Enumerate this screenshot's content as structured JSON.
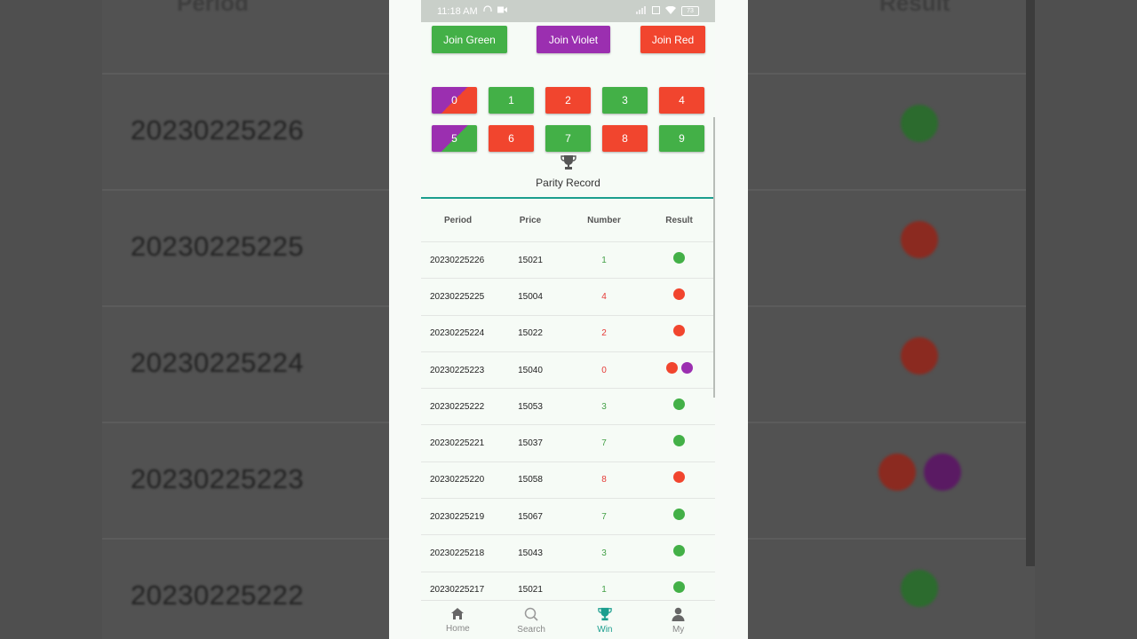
{
  "background": {
    "header_period": "Period",
    "header_result": "Result",
    "rows": [
      {
        "period": "20230225226",
        "dots": [
          "#2c6b2e"
        ]
      },
      {
        "period": "20230225225",
        "dots": [
          "#8b2a20"
        ]
      },
      {
        "period": "20230225224",
        "dots": [
          "#8b2a20"
        ]
      },
      {
        "period": "20230225223",
        "dots": [
          "#8b2a20",
          "#5a1a63"
        ]
      },
      {
        "period": "20230225222",
        "dots": [
          "#2c6b2e"
        ]
      }
    ]
  },
  "status_bar": {
    "time": "11:18 AM",
    "battery": "73"
  },
  "join_buttons": {
    "green": "Join Green",
    "violet": "Join Violet",
    "red": "Join Red"
  },
  "numbers": [
    "0",
    "1",
    "2",
    "3",
    "4",
    "5",
    "6",
    "7",
    "8",
    "9"
  ],
  "record": {
    "tab_label": "Parity Record",
    "headers": {
      "period": "Period",
      "price": "Price",
      "number": "Number",
      "result": "Result"
    },
    "rows": [
      {
        "period": "20230225226",
        "price": "15021",
        "number": "1",
        "number_color": "#43a047",
        "dots": [
          "green"
        ]
      },
      {
        "period": "20230225225",
        "price": "15004",
        "number": "4",
        "number_color": "#e53935",
        "dots": [
          "red"
        ]
      },
      {
        "period": "20230225224",
        "price": "15022",
        "number": "2",
        "number_color": "#e53935",
        "dots": [
          "red"
        ]
      },
      {
        "period": "20230225223",
        "price": "15040",
        "number": "0",
        "number_color": "#e53935",
        "dots": [
          "red",
          "violet"
        ]
      },
      {
        "period": "20230225222",
        "price": "15053",
        "number": "3",
        "number_color": "#43a047",
        "dots": [
          "green"
        ]
      },
      {
        "period": "20230225221",
        "price": "15037",
        "number": "7",
        "number_color": "#43a047",
        "dots": [
          "green"
        ]
      },
      {
        "period": "20230225220",
        "price": "15058",
        "number": "8",
        "number_color": "#e53935",
        "dots": [
          "red"
        ]
      },
      {
        "period": "20230225219",
        "price": "15067",
        "number": "7",
        "number_color": "#43a047",
        "dots": [
          "green"
        ]
      },
      {
        "period": "20230225218",
        "price": "15043",
        "number": "3",
        "number_color": "#43a047",
        "dots": [
          "green"
        ]
      },
      {
        "period": "20230225217",
        "price": "15021",
        "number": "1",
        "number_color": "#43a047",
        "dots": [
          "green"
        ]
      }
    ]
  },
  "colors": {
    "green": "#43b047",
    "red": "#f1452e",
    "violet": "#9b2fb0",
    "accent": "#1b9e8e"
  },
  "nav": [
    {
      "label": "Home",
      "icon": "home-icon"
    },
    {
      "label": "Search",
      "icon": "search-icon"
    },
    {
      "label": "Win",
      "icon": "trophy-icon",
      "active": true
    },
    {
      "label": "My",
      "icon": "person-icon"
    }
  ]
}
